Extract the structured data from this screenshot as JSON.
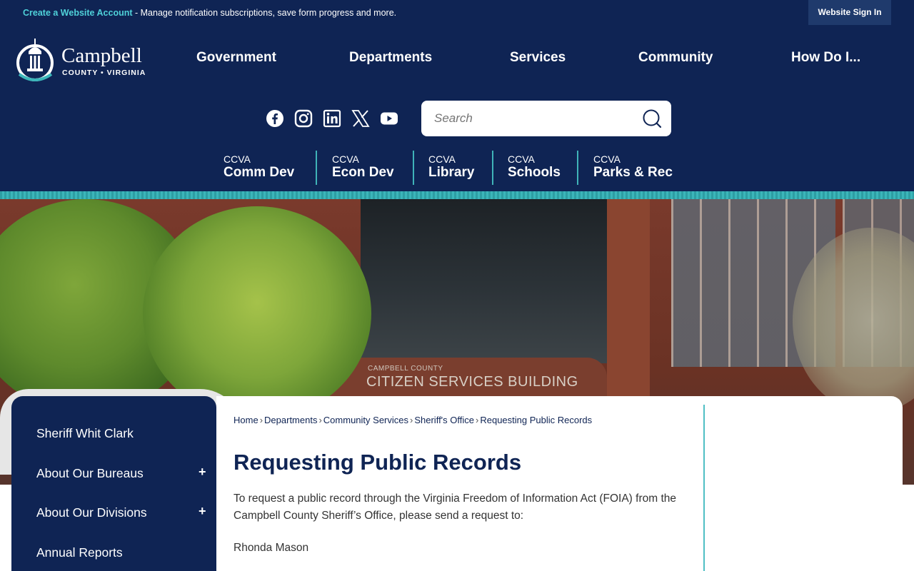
{
  "topbar": {
    "create_link": "Create a Website Account",
    "message": " - Manage notification subscriptions, save form progress and more.",
    "signin_label": "Website Sign In"
  },
  "logo": {
    "name": "Campbell",
    "subtitle": "COUNTY • VIRGINIA"
  },
  "nav": {
    "items": [
      "Government",
      "Departments",
      "Services",
      "Community",
      "How Do I..."
    ]
  },
  "social": {
    "icons": [
      "facebook-icon",
      "instagram-icon",
      "linkedin-icon",
      "x-icon",
      "youtube-icon"
    ]
  },
  "search": {
    "placeholder": "Search"
  },
  "quick_links": [
    {
      "small": "CCVA",
      "large": "Comm Dev"
    },
    {
      "small": "CCVA",
      "large": "Econ Dev"
    },
    {
      "small": "CCVA",
      "large": "Library"
    },
    {
      "small": "CCVA",
      "large": "Schools"
    },
    {
      "small": "CCVA",
      "large": "Parks & Rec"
    }
  ],
  "hero": {
    "sign_top": "CAMPBELL COUNTY",
    "sign_main": "CITIZEN SERVICES BUILDING"
  },
  "sidebar": {
    "items": [
      {
        "label": "Sheriff Whit Clark",
        "expandable": false
      },
      {
        "label": "About Our Bureaus",
        "expandable": true
      },
      {
        "label": "About Our Divisions",
        "expandable": true
      },
      {
        "label": "Annual Reports",
        "expandable": false
      }
    ],
    "expand_glyph": "+"
  },
  "breadcrumb": {
    "items": [
      "Home",
      "Departments",
      "Community Services",
      "Sheriff's Office",
      "Requesting Public Records"
    ],
    "separator": "›"
  },
  "page": {
    "title": "Requesting Public Records",
    "intro": "To request a public record through the Virginia Freedom of Information Act (FOIA) from the Campbell County Sheriff’s Office, please send a request to:",
    "contact_name": "Rhonda Mason"
  },
  "colors": {
    "navy": "#0f2454",
    "teal": "#3bb6ba",
    "link_teal": "#4fd1d9"
  }
}
